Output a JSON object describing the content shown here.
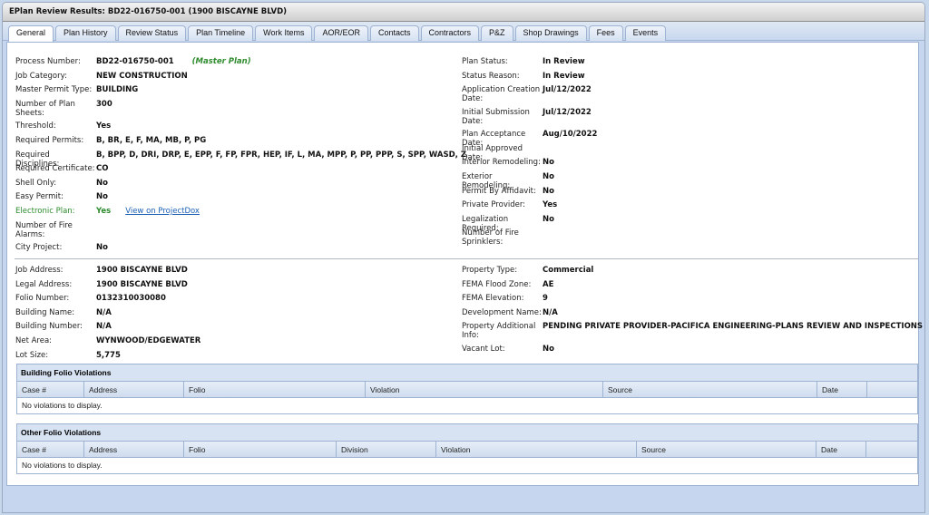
{
  "window": {
    "title": "EPlan Review Results: BD22-016750-001  (1900 BISCAYNE BLVD)"
  },
  "tabs": [
    {
      "label": "General",
      "active": true
    },
    {
      "label": "Plan History"
    },
    {
      "label": "Review Status"
    },
    {
      "label": "Plan Timeline"
    },
    {
      "label": "Work Items"
    },
    {
      "label": "AOR/EOR"
    },
    {
      "label": "Contacts"
    },
    {
      "label": "Contractors"
    },
    {
      "label": "P&Z"
    },
    {
      "label": "Shop Drawings"
    },
    {
      "label": "Fees"
    },
    {
      "label": "Events"
    }
  ],
  "general": {
    "left": [
      {
        "label": "Process Number:",
        "value": "BD22-016750-001",
        "note": "(Master Plan)"
      },
      {
        "label": "Job Category:",
        "value": "NEW CONSTRUCTION"
      },
      {
        "label": "Master Permit Type:",
        "value": "BUILDING"
      },
      {
        "label": "Number of Plan Sheets:",
        "value": "300"
      },
      {
        "label": "Threshold:",
        "value": "Yes"
      },
      {
        "label": "Required Permits:",
        "value": "B, BR, E, F, MA, MB, P, PG"
      },
      {
        "label": "Required Disciplines:",
        "value": "B, BPP, D, DRI, DRP, E, EPP, F, FP, FPR, HEP, IF, L, MA, MPP, P, PP, PPP, S, SPP, WASD, Z"
      },
      {
        "label": "Required Certificate:",
        "value": "CO"
      },
      {
        "label": "Shell Only:",
        "value": "No"
      },
      {
        "label": "Easy Permit:",
        "value": "No"
      },
      {
        "label": "Electronic Plan:",
        "value": "Yes",
        "link": "View on ProjectDox"
      },
      {
        "label": "Number of Fire Alarms:",
        "value": ""
      },
      {
        "label": "City Project:",
        "value": "No"
      }
    ],
    "right": [
      {
        "label": "Plan Status:",
        "value": "In Review"
      },
      {
        "label": "Status Reason:",
        "value": "In Review"
      },
      {
        "label": "Application Creation Date:",
        "value": "Jul/12/2022"
      },
      {
        "label": "Initial Submission Date:",
        "value": "Jul/12/2022"
      },
      {
        "label": "Plan Acceptance Date:",
        "value": "Aug/10/2022"
      },
      {
        "label": "Initial Approved Date:",
        "value": ""
      },
      {
        "label": "Interior Remodeling:",
        "value": "No"
      },
      {
        "label": "Exterior Remodeling:",
        "value": "No"
      },
      {
        "label": "Permit By Affidavit:",
        "value": "No"
      },
      {
        "label": "Private Provider:",
        "value": "Yes"
      },
      {
        "label": "Legalization Required:",
        "value": "No"
      },
      {
        "label": "Number of Fire Sprinklers:",
        "value": ""
      }
    ]
  },
  "address": {
    "left": [
      {
        "label": "Job Address:",
        "value": "1900 BISCAYNE BLVD"
      },
      {
        "label": "Legal Address:",
        "value": "1900 BISCAYNE BLVD"
      },
      {
        "label": "Folio Number:",
        "value": "0132310030080"
      },
      {
        "label": "Building Name:",
        "value": "N/A"
      },
      {
        "label": "Building Number:",
        "value": "N/A"
      },
      {
        "label": "Net Area:",
        "value": "WYNWOOD/EDGEWATER"
      },
      {
        "label": "Lot Size:",
        "value": "5,775"
      }
    ],
    "right": [
      {
        "label": "Property Type:",
        "value": "Commercial"
      },
      {
        "label": "FEMA Flood Zone:",
        "value": "AE"
      },
      {
        "label": "FEMA Elevation:",
        "value": "9"
      },
      {
        "label": "Development Name:",
        "value": "N/A"
      },
      {
        "label": "Property Additional Info:",
        "value": "PENDING PRIVATE PROVIDER-PACIFICA ENGINEERING-PLANS REVIEW AND INSPECTIONS"
      },
      {
        "label": "Vacant Lot:",
        "value": "No"
      }
    ]
  },
  "building_violations": {
    "title": "Building Folio Violations",
    "columns": [
      "Case #",
      "Address",
      "Folio",
      "Violation",
      "Source",
      "Date",
      ""
    ],
    "empty_text": "No violations to display."
  },
  "other_violations": {
    "title": "Other Folio Violations",
    "columns": [
      "Case #",
      "Address",
      "Folio",
      "Division",
      "Violation",
      "Source",
      "Date",
      ""
    ],
    "empty_text": "No violations to display."
  }
}
